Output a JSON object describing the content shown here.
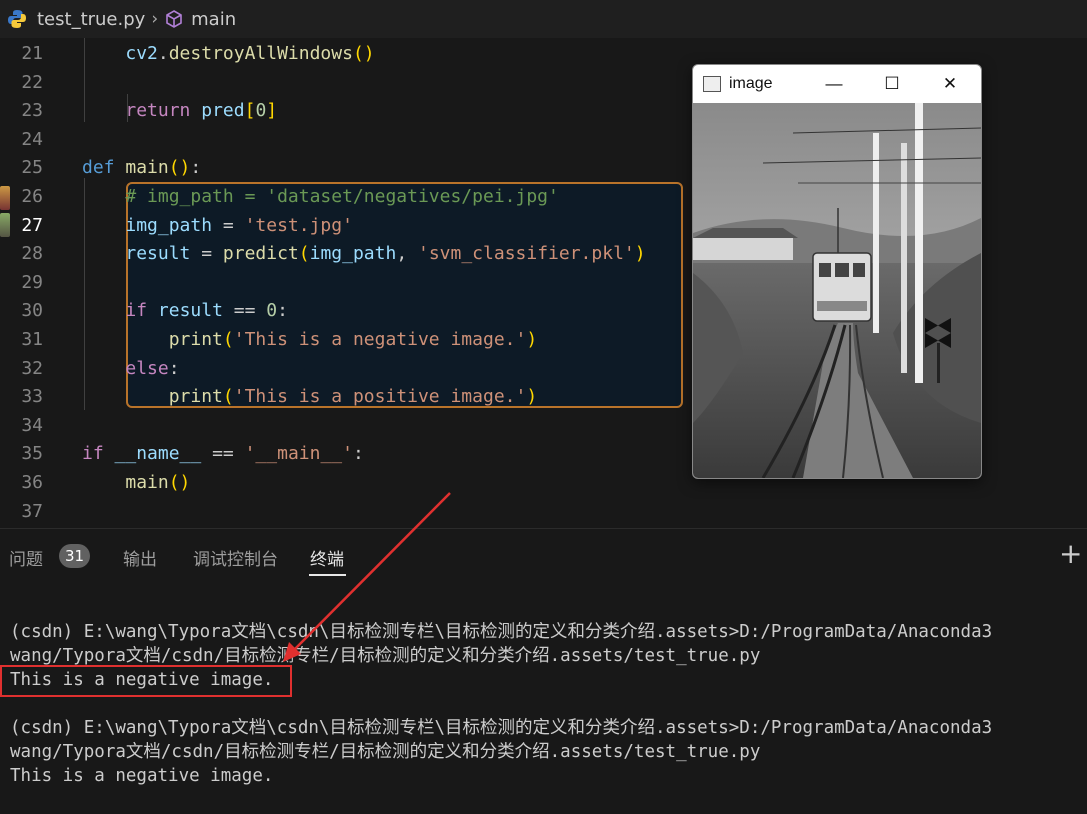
{
  "breadcrumb": {
    "file": "test_true.py",
    "symbol": "main"
  },
  "editor": {
    "lines": [
      {
        "n": "21",
        "tokens": [
          [
            "pl",
            "    "
          ],
          [
            "var",
            "cv2"
          ],
          [
            "pl",
            "."
          ],
          [
            "fn",
            "destroyAllWindows"
          ],
          [
            "br1",
            "()"
          ]
        ]
      },
      {
        "n": "22",
        "tokens": []
      },
      {
        "n": "23",
        "tokens": [
          [
            "pl",
            "    "
          ],
          [
            "kw",
            "return"
          ],
          [
            "pl",
            " "
          ],
          [
            "var",
            "pred"
          ],
          [
            "br1",
            "["
          ],
          [
            "num",
            "0"
          ],
          [
            "br1",
            "]"
          ]
        ]
      },
      {
        "n": "24",
        "tokens": []
      },
      {
        "n": "25",
        "tokens": [
          [
            "def",
            "def"
          ],
          [
            "pl",
            " "
          ],
          [
            "fn",
            "main"
          ],
          [
            "br1",
            "()"
          ],
          [
            "pl",
            ":"
          ]
        ]
      },
      {
        "n": "26",
        "tokens": [
          [
            "pl",
            "    "
          ],
          [
            "com",
            "# img_path = 'dataset/negatives/pei.jpg'"
          ]
        ]
      },
      {
        "n": "27",
        "tokens": [
          [
            "pl",
            "    "
          ],
          [
            "var",
            "img_path"
          ],
          [
            "pl",
            " = "
          ],
          [
            "str",
            "'test.jpg'"
          ]
        ],
        "current": true
      },
      {
        "n": "28",
        "tokens": [
          [
            "pl",
            "    "
          ],
          [
            "var",
            "result"
          ],
          [
            "pl",
            " = "
          ],
          [
            "fn",
            "predict"
          ],
          [
            "br1",
            "("
          ],
          [
            "var",
            "img_path"
          ],
          [
            "pl",
            ", "
          ],
          [
            "str",
            "'svm_classifier.pkl'"
          ],
          [
            "br1",
            ")"
          ]
        ]
      },
      {
        "n": "29",
        "tokens": []
      },
      {
        "n": "30",
        "tokens": [
          [
            "pl",
            "    "
          ],
          [
            "kw",
            "if"
          ],
          [
            "pl",
            " "
          ],
          [
            "var",
            "result"
          ],
          [
            "pl",
            " == "
          ],
          [
            "num",
            "0"
          ],
          [
            "pl",
            ":"
          ]
        ]
      },
      {
        "n": "31",
        "tokens": [
          [
            "pl",
            "        "
          ],
          [
            "fn",
            "print"
          ],
          [
            "br1",
            "("
          ],
          [
            "str",
            "'This is a negative image.'"
          ],
          [
            "br1",
            ")"
          ]
        ]
      },
      {
        "n": "32",
        "tokens": [
          [
            "pl",
            "    "
          ],
          [
            "kw",
            "else"
          ],
          [
            "pl",
            ":"
          ]
        ]
      },
      {
        "n": "33",
        "tokens": [
          [
            "pl",
            "        "
          ],
          [
            "fn",
            "print"
          ],
          [
            "br1",
            "("
          ],
          [
            "str",
            "'This is a positive image.'"
          ],
          [
            "br1",
            ")"
          ]
        ]
      },
      {
        "n": "34",
        "tokens": []
      },
      {
        "n": "35",
        "tokens": [
          [
            "kw",
            "if"
          ],
          [
            "pl",
            " "
          ],
          [
            "var",
            "__name__"
          ],
          [
            "pl",
            " == "
          ],
          [
            "str",
            "'__main__'"
          ],
          [
            "pl",
            ":"
          ]
        ]
      },
      {
        "n": "36",
        "tokens": [
          [
            "pl",
            "    "
          ],
          [
            "fn",
            "main"
          ],
          [
            "br1",
            "()"
          ]
        ]
      },
      {
        "n": "37",
        "tokens": []
      }
    ]
  },
  "image_window": {
    "title": "image",
    "minimize": "—",
    "maximize": "☐",
    "close": "✕"
  },
  "panel": {
    "tabs": [
      {
        "label": "问题",
        "active": false
      },
      {
        "label": "输出",
        "active": false
      },
      {
        "label": "调试控制台",
        "active": false
      },
      {
        "label": "终端",
        "active": true
      }
    ],
    "problems_count": "31",
    "add_label": "+"
  },
  "terminal": {
    "lines": [
      "(csdn) E:\\wang\\Typora文档\\csdn\\目标检测专栏\\目标检测的定义和分类介绍.assets>D:/ProgramData/Anaconda3",
      "wang/Typora文档/csdn/目标检测专栏/目标检测的定义和分类介绍.assets/test_true.py",
      "This is a negative image.",
      "",
      "(csdn) E:\\wang\\Typora文档\\csdn\\目标检测专栏\\目标检测的定义和分类介绍.assets>D:/ProgramData/Anaconda3",
      "wang/Typora文档/csdn/目标检测专栏/目标检测的定义和分类介绍.assets/test_true.py",
      "This is a negative image."
    ]
  },
  "colors": {
    "annotation_box": "#b8732a",
    "highlight_box": "#e0302f",
    "arrow": "#e0302f"
  },
  "icons": [
    "python-file-icon",
    "symbol-method-icon",
    "window-app-icon",
    "plus-icon"
  ]
}
